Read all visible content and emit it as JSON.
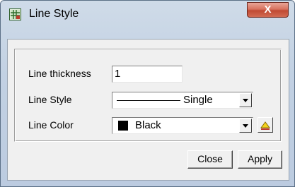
{
  "window": {
    "title": "Line Style",
    "close_glyph": "X",
    "icon": "app-grid-icon"
  },
  "form": {
    "thickness": {
      "label": "Line thickness",
      "value": "1"
    },
    "style": {
      "label": "Line Style",
      "value": "Single"
    },
    "color": {
      "label": "Line Color",
      "value": "Black",
      "swatch": "#000000"
    }
  },
  "icons": {
    "dropdown": "chevron-down-icon",
    "color_picker": "color-picker-icon"
  },
  "buttons": {
    "close": "Close",
    "apply": "Apply"
  },
  "colors": {
    "close_button": "#c04a33",
    "dialog_face": "#f0f0f0"
  }
}
